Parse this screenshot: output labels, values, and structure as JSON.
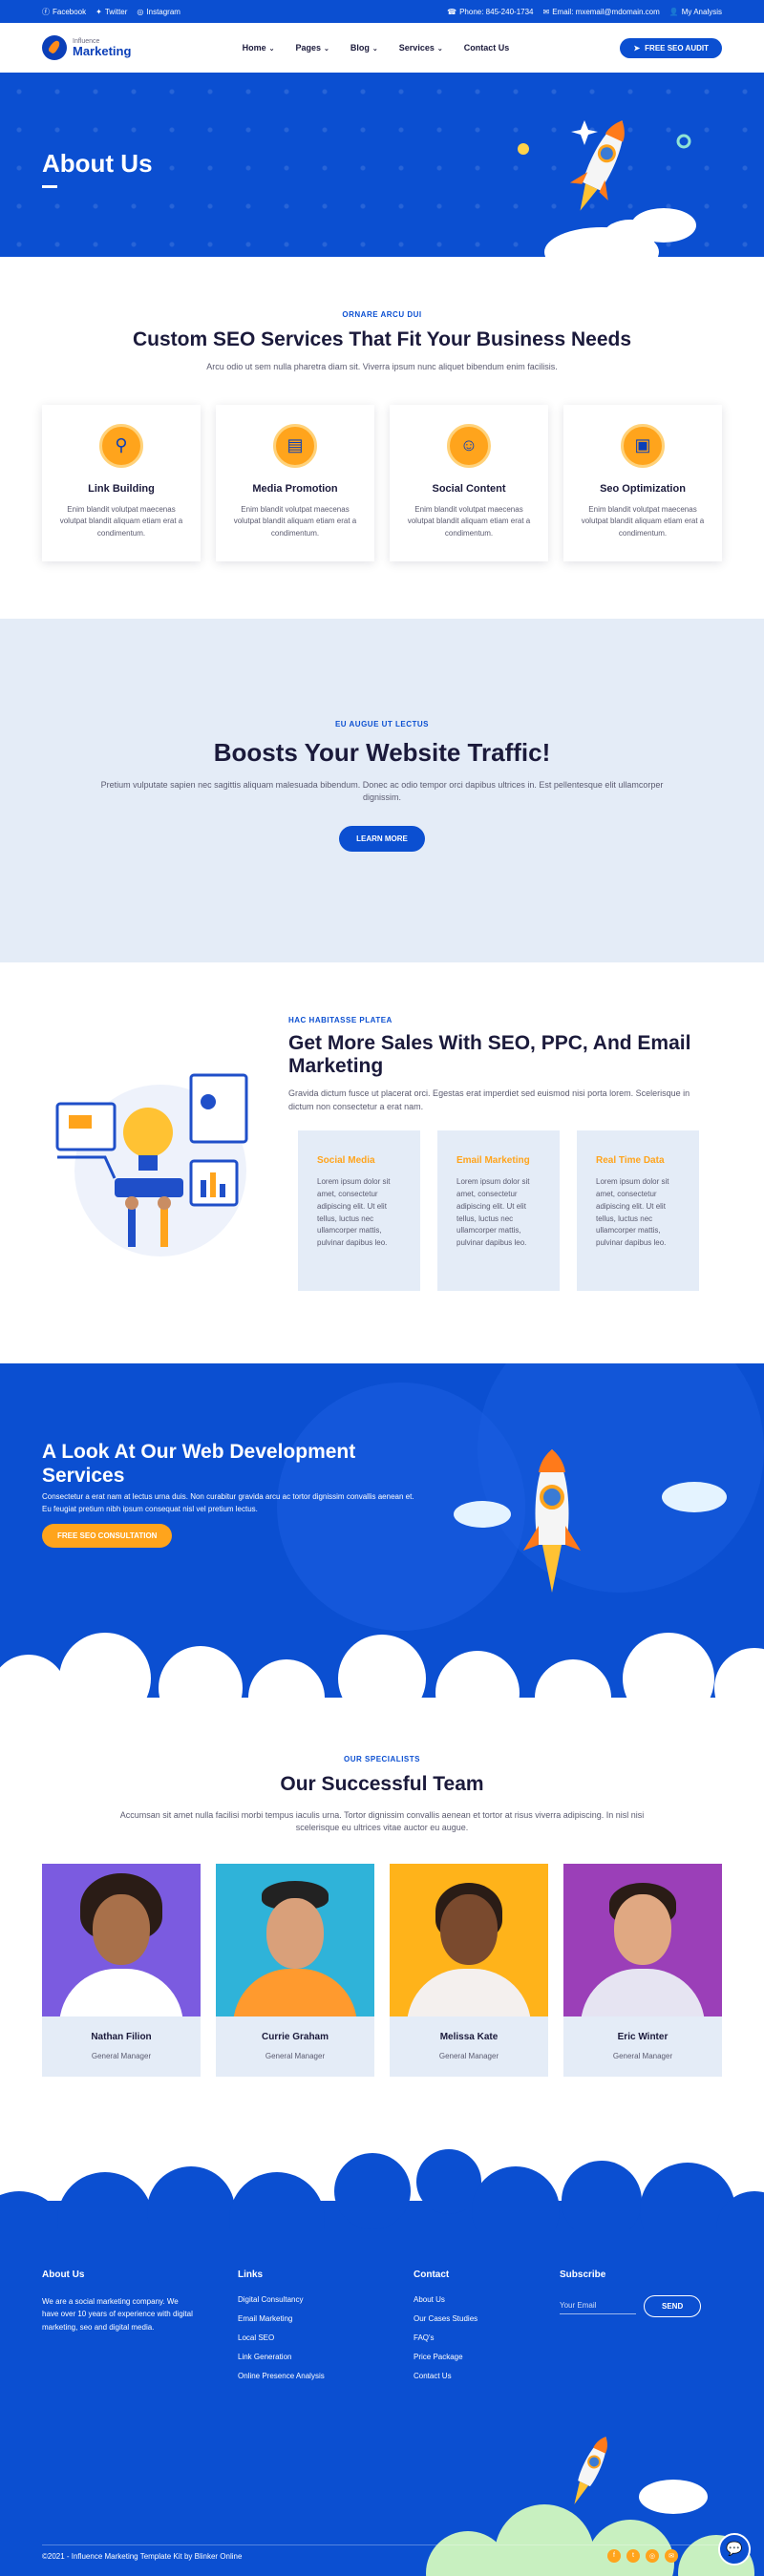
{
  "topbar": {
    "social": [
      "Facebook",
      "Twitter",
      "Instagram"
    ],
    "phone": "Phone: 845-240-1734",
    "email": "Email: mxemail@mdomain.com",
    "account": "My Analysis"
  },
  "header": {
    "logo_small": "Influence",
    "logo_big": "Marketing",
    "nav": [
      "Home",
      "Pages",
      "Blog",
      "Services",
      "Contact Us"
    ],
    "cta": "FREE SEO AUDIT"
  },
  "hero": {
    "title": "About Us"
  },
  "services": {
    "eyebrow": "ORNARE ARCU DUI",
    "title": "Custom SEO Services That Fit Your Business Needs",
    "lead": "Arcu odio ut sem nulla pharetra diam sit. Viverra ipsum nunc aliquet bibendum enim facilisis.",
    "cards": [
      {
        "title": "Link Building",
        "text": "Enim blandit volutpat maecenas volutpat blandit aliquam etiam erat a condimentum."
      },
      {
        "title": "Media Promotion",
        "text": "Enim blandit volutpat maecenas volutpat blandit aliquam etiam erat a condimentum."
      },
      {
        "title": "Social Content",
        "text": "Enim blandit volutpat maecenas volutpat blandit aliquam etiam erat a condimentum."
      },
      {
        "title": "Seo Optimization",
        "text": "Enim blandit volutpat maecenas volutpat blandit aliquam etiam erat a condimentum."
      }
    ]
  },
  "traffic": {
    "eyebrow": "EU AUGUE UT LECTUS",
    "title": "Boosts Your Website Traffic!",
    "lead": "Pretium vulputate sapien nec sagittis aliquam malesuada bibendum. Donec ac odio tempor orci dapibus ultrices in. Est pellentesque elit ullamcorper dignissim.",
    "button": "LEARN MORE"
  },
  "sales": {
    "eyebrow": "HAC HABITASSE PLATEA",
    "title": "Get More Sales With SEO, PPC, And Email Marketing",
    "lead": "Gravida dictum fusce ut placerat orci. Egestas erat imperdiet sed euismod nisi porta lorem. Scelerisque in dictum non consectetur a erat nam.",
    "cards": [
      {
        "title": "Social Media",
        "text": "Lorem ipsum dolor sit amet, consectetur adipiscing elit. Ut elit tellus, luctus nec ullamcorper mattis, pulvinar dapibus leo."
      },
      {
        "title": "Email Marketing",
        "text": "Lorem ipsum dolor sit amet, consectetur adipiscing elit. Ut elit tellus, luctus nec ullamcorper mattis, pulvinar dapibus leo."
      },
      {
        "title": "Real Time Data",
        "text": "Lorem ipsum dolor sit amet, consectetur adipiscing elit. Ut elit tellus, luctus nec ullamcorper mattis, pulvinar dapibus leo."
      }
    ]
  },
  "webdev": {
    "title": "A Look At Our Web Development Services",
    "text": "Consectetur a erat nam at lectus urna duis. Non curabitur gravida arcu ac tortor dignissim convallis aenean et. Eu feugiat pretium nibh ipsum consequat nisl vel pretium lectus.",
    "button": "FREE SEO CONSULTATION"
  },
  "team": {
    "eyebrow": "OUR SPECIALISTS",
    "title": "Our Successful Team",
    "lead": "Accumsan sit amet nulla facilisi morbi tempus iaculis urna. Tortor dignissim convallis aenean et tortor at risus viverra adipiscing. In nisl nisi scelerisque eu ultrices vitae auctor eu augue.",
    "members": [
      {
        "name": "Nathan Filion",
        "role": "General Manager",
        "bg": "#7b5be0",
        "shirt": "#ffffff"
      },
      {
        "name": "Currie Graham",
        "role": "General Manager",
        "bg": "#2fb3d9",
        "shirt": "#ff9a2e"
      },
      {
        "name": "Melissa Kate",
        "role": "General Manager",
        "bg": "#ffb31a",
        "shirt": "#f4f0ee"
      },
      {
        "name": "Eric Winter",
        "role": "General Manager",
        "bg": "#9b3fb8",
        "shirt": "#e6e4f2"
      }
    ]
  },
  "footer": {
    "about_title": "About Us",
    "about_text": "We are a social marketing company. We have over 10 years of experience with digital marketing, seo and digital media.",
    "links_title": "Links",
    "links": [
      "Digital Consultancy",
      "Email Marketing",
      "Local SEO",
      "Link Generation",
      "Online Presence Analysis"
    ],
    "contact_title": "Contact",
    "contact": [
      "About Us",
      "Our Cases Studies",
      "FAQ's",
      "Price Package",
      "Contact Us"
    ],
    "subscribe_title": "Subscribe",
    "email_placeholder": "Your Email",
    "send": "SEND",
    "copyright": "©2021 - Influence Marketing Template Kit by Blinker Online"
  },
  "colors": {
    "brand_blue": "#0b4fd1",
    "accent_orange": "#ffa41c",
    "light_bg": "#e4ecf7",
    "dark_text": "#1b1a3b"
  }
}
